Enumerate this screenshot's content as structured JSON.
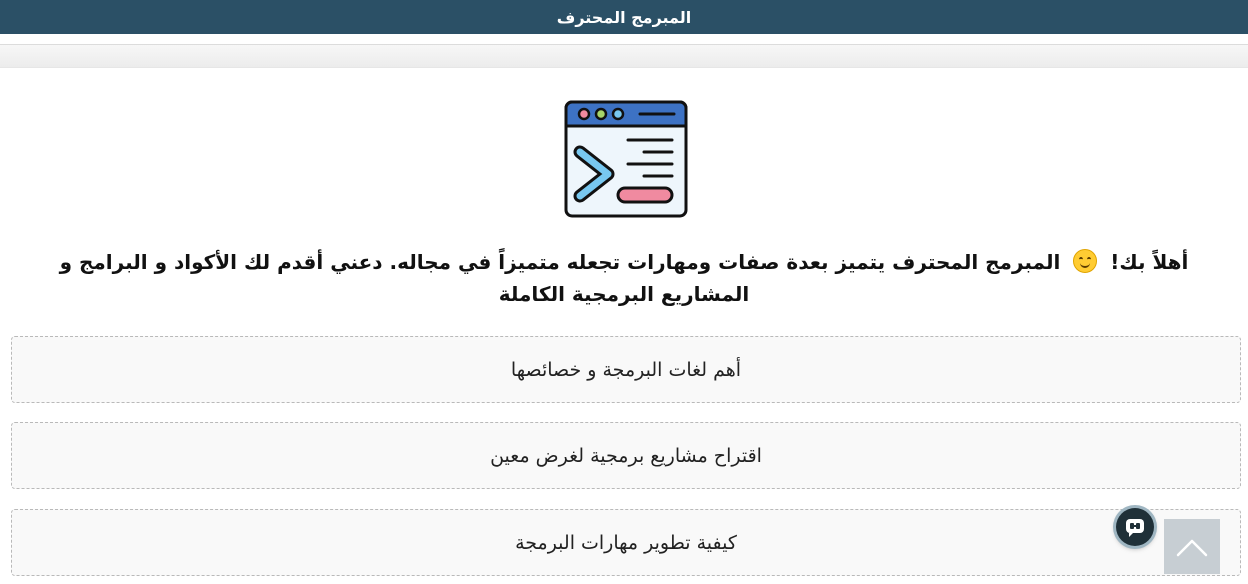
{
  "header": {
    "title": "المبرمج المحترف"
  },
  "welcome": {
    "before_emoji": "أهلاً بك!",
    "after_emoji": "المبرمج المحترف يتميز بعدة صفات ومهارات تجعله متميزاً في مجاله. دعني أقدم لك الأكواد و البرامج و المشاريع البرمجية الكاملة"
  },
  "options": [
    {
      "label": "أهم لغات البرمجة و خصائصها"
    },
    {
      "label": "اقتراح مشاريع برمجية لغرض معين"
    },
    {
      "label": "كيفية تطوير مهارات البرمجة"
    }
  ],
  "icons": {
    "logo": "terminal-window-icon",
    "emoji": "smiling-face-icon",
    "chat": "chat-bot-icon",
    "scroll": "chevron-up-icon"
  },
  "colors": {
    "header_bg": "#2b5066",
    "window_bar": "#3d72c4",
    "prompt": "#78c8f0",
    "cursor_line": "#f08aa0"
  }
}
